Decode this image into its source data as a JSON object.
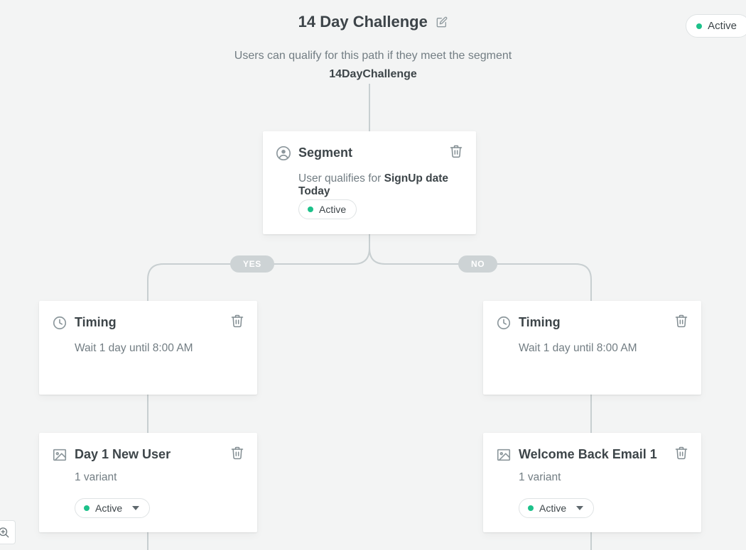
{
  "header": {
    "title": "14 Day Challenge",
    "subtitle_prefix": "Users can qualify for this path if they meet the segment",
    "segment_name": "14DayChallenge",
    "status": "Active"
  },
  "branch": {
    "yes_label": "YES",
    "no_label": "NO"
  },
  "nodes": {
    "segment": {
      "title": "Segment",
      "line_prefix": "User qualifies for ",
      "line_bold": "SignUp date Today",
      "status": "Active"
    },
    "timing_left": {
      "title": "Timing",
      "line": "Wait 1 day until 8:00 AM"
    },
    "timing_right": {
      "title": "Timing",
      "line": "Wait 1 day until 8:00 AM"
    },
    "email_left": {
      "title": "Day 1 New User",
      "variants": "1 variant",
      "status": "Active"
    },
    "email_right": {
      "title": "Welcome Back Email 1",
      "variants": "1 variant",
      "status": "Active"
    }
  },
  "icons": {
    "edit": "pencil-icon",
    "trash": "trash-icon",
    "segment": "user-circle-icon",
    "timing": "clock-icon",
    "email": "image-icon",
    "caret": "caret-down-icon",
    "zoom": "zoom-in-icon",
    "status_dot": "status-dot-icon"
  }
}
